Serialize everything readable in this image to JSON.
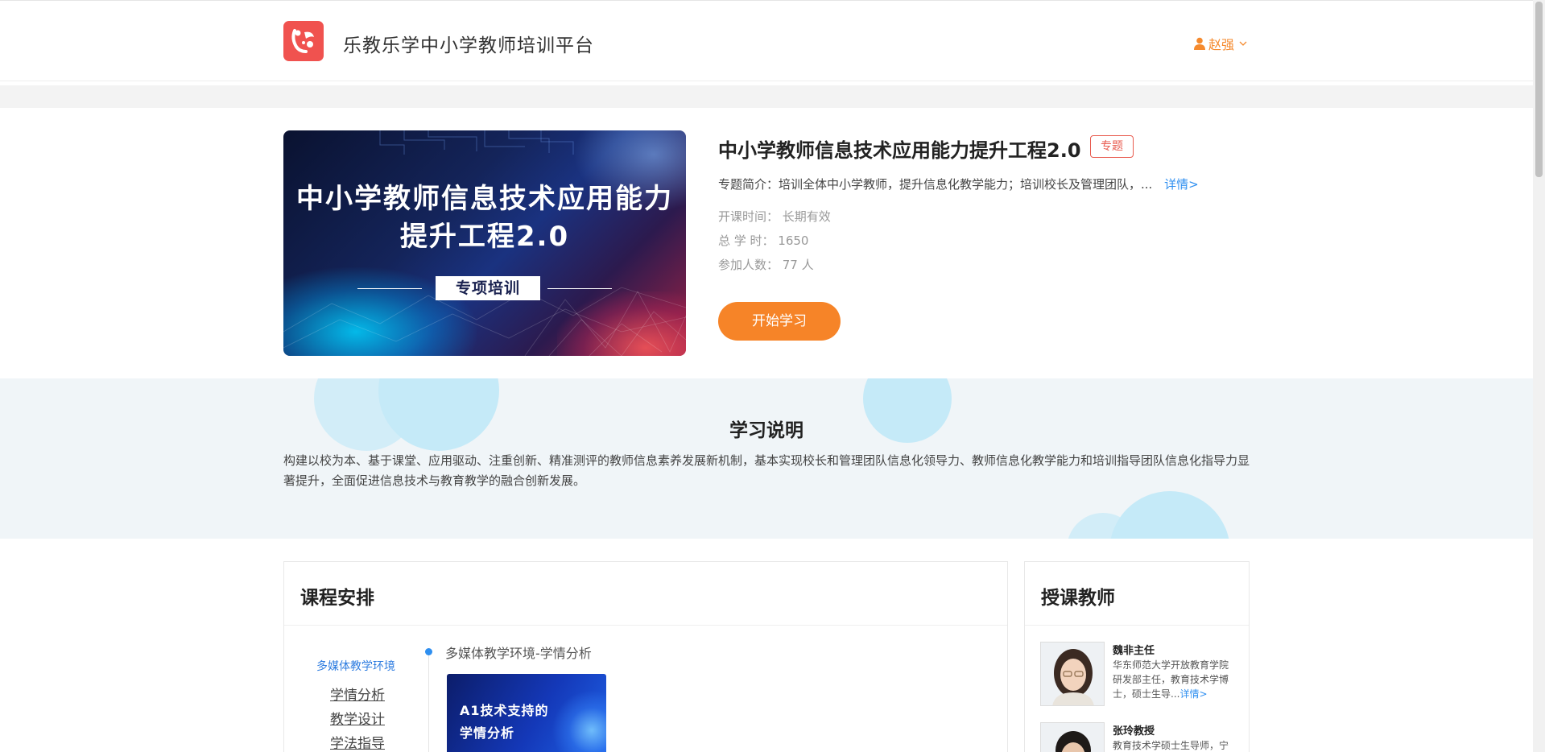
{
  "header": {
    "site_title": "乐教乐学中小学教师培训平台",
    "user_name": "赵强",
    "user_icon": "user-icon",
    "accent": "#f58a2e"
  },
  "banner": {
    "line1": "中小学教师信息技术应用能力",
    "line2": "提升工程2.0",
    "tag": "专项培训"
  },
  "course": {
    "title": "中小学教师信息技术应用能力提升工程2.0",
    "badge": "专题",
    "intro": "专题简介：培训全体中小学教师，提升信息化教学能力；培训校长及管理团队，...",
    "intro_more": "详情>",
    "start_time": "开课时间：  长期有效",
    "total_hours": "总  学  时：  1650",
    "participants": "参加人数：  77 人",
    "start_button": "开始学习"
  },
  "study": {
    "title": "学习说明",
    "text": "构建以校为本、基于课堂、应用驱动、注重创新、精准测评的教师信息素养发展新机制，基本实现校长和管理团队信息化领导力、教师信息化教学能力和培训指导团队信息化指导力显著提升，全面促进信息技术与教育教学的融合创新发展。"
  },
  "schedule": {
    "title": "课程安排",
    "active_category": "多媒体教学环境",
    "categories": [
      "学情分析",
      "教学设计",
      "学法指导"
    ],
    "lesson_title": "多媒体教学环境-学情分析",
    "thumb_line1": "A1技术支持的",
    "thumb_line2": "学情分析"
  },
  "teachers": {
    "title": "授课教师",
    "list": [
      {
        "name": "魏非主任",
        "desc": "华东师范大学开放教育学院研发部主任，教育技术学博士，硕士生导...",
        "more": "详情>"
      },
      {
        "name": "张玲教授",
        "desc": "教育技术学硕士生导师，宁"
      }
    ]
  },
  "colors": {
    "brand_red": "#f0524f",
    "orange": "#f68428",
    "link_blue": "#2f8ff0"
  }
}
